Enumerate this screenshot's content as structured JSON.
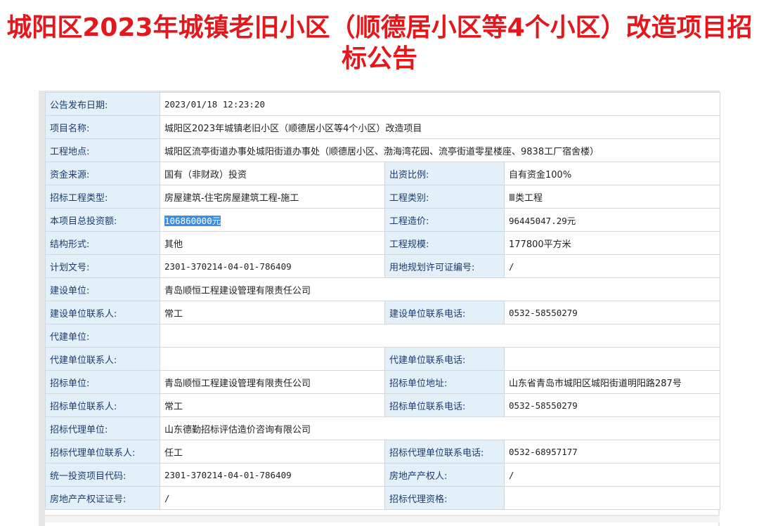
{
  "title_line1": "城阳区2023年城镇老旧小区（顺德居小区等4个小区）改造项目招",
  "title_line2": "标公告",
  "rows": [
    {
      "l1": "公告发布日期:",
      "v1": "2023/01/18 12:23:20"
    },
    {
      "l1": "项目名称:",
      "v1": "城阳区2023年城镇老旧小区（顺德居小区等4个小区）改造项目"
    },
    {
      "l1": "工程地点:",
      "v1": "城阳区流亭街道办事处城阳街道办事处（顺德居小区、渤海湾花园、流亭街道零星楼座、9838工厂宿舍楼）"
    },
    {
      "l1": "资金来源:",
      "v1": "国有（非财政）投资",
      "l2": "出资比例:",
      "v2": "自有资金100%"
    },
    {
      "l1": "招标工程类型:",
      "v1": "房屋建筑-住宅房屋建筑工程-施工",
      "l2": "工程类别:",
      "v2": "Ⅲ类工程"
    },
    {
      "l1": "本项目总投资额:",
      "v1": "106860000元",
      "l2": "工程造价:",
      "v2": "96445047.29元"
    },
    {
      "l1": "结构形式:",
      "v1": "其他",
      "l2": "工程规模:",
      "v2": "177800平方米"
    },
    {
      "l1": "计划文号:",
      "v1": "2301-370214-04-01-786409",
      "l2": "用地规划许可证编号:",
      "v2": "/"
    },
    {
      "l1": "建设单位:",
      "v1": "青岛顺恒工程建设管理有限责任公司"
    },
    {
      "l1": "建设单位联系人:",
      "v1": "常工",
      "l2": "建设单位联系电话:",
      "v2": "0532-58550279"
    },
    {
      "l1": "代建单位:",
      "v1": ""
    },
    {
      "l1": "代建单位联系人:",
      "v1": "",
      "l2": "代建单位联系电话:",
      "v2": ""
    },
    {
      "l1": "招标单位:",
      "v1": "青岛顺恒工程建设管理有限责任公司",
      "l2": "招标单位地址:",
      "v2": "山东省青岛市城阳区城阳街道明阳路287号"
    },
    {
      "l1": "招标单位联系人:",
      "v1": "常工",
      "l2": "招标单位联系电话:",
      "v2": "0532-58550279"
    },
    {
      "l1": "招标代理单位:",
      "v1": "山东德勤招标评估造价咨询有限公司"
    },
    {
      "l1": "招标代理单位联系人:",
      "v1": "任工",
      "l2": "招标代理单位联系电话:",
      "v2": "0532-68957177"
    },
    {
      "l1": "统一投资项目代码:",
      "v1": "2301-370214-04-01-786409",
      "l2": "房地产产权人:",
      "v2": "/"
    },
    {
      "l1": "房地产产权证证号:",
      "v1": "/",
      "l2": "招标代理资格:",
      "v2": ""
    }
  ]
}
